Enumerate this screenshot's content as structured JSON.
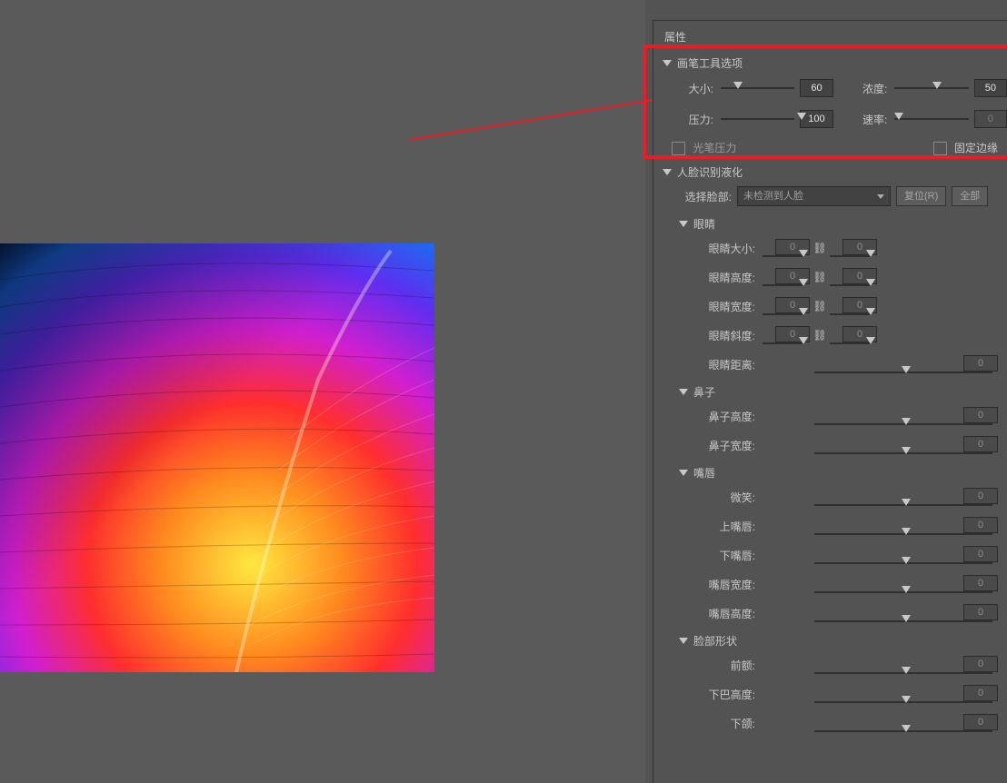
{
  "panel": {
    "title": "属性",
    "brush": {
      "header": "画笔工具选项",
      "size_label": "大小:",
      "size_value": "60",
      "density_label": "浓度:",
      "density_value": "50",
      "pressure_label": "压力:",
      "pressure_value": "100",
      "rate_label": "速率:",
      "rate_value": "0",
      "stylus_pressure": "光笔压力",
      "pin_edges": "固定边缘"
    },
    "face": {
      "header": "人脸识别液化",
      "select_label": "选择脸部:",
      "select_value": "未检测到人脸",
      "reset_btn": "复位(R)",
      "all_btn": "全部",
      "eyes": {
        "header": "眼睛",
        "size": "眼睛大小:",
        "height": "眼睛高度:",
        "width": "眼睛宽度:",
        "tilt": "眼睛斜度:",
        "distance": "眼睛距离:",
        "val": "0"
      },
      "nose": {
        "header": "鼻子",
        "height": "鼻子高度:",
        "width": "鼻子宽度:",
        "val": "0"
      },
      "mouth": {
        "header": "嘴唇",
        "smile": "微笑:",
        "upper": "上嘴唇:",
        "lower": "下嘴唇:",
        "mwidth": "嘴唇宽度:",
        "mheight": "嘴唇高度:",
        "val": "0"
      },
      "shape": {
        "header": "脸部形状",
        "forehead": "前额:",
        "chin_h": "下巴高度:",
        "jawline": "下颌:",
        "val": "0"
      }
    }
  }
}
